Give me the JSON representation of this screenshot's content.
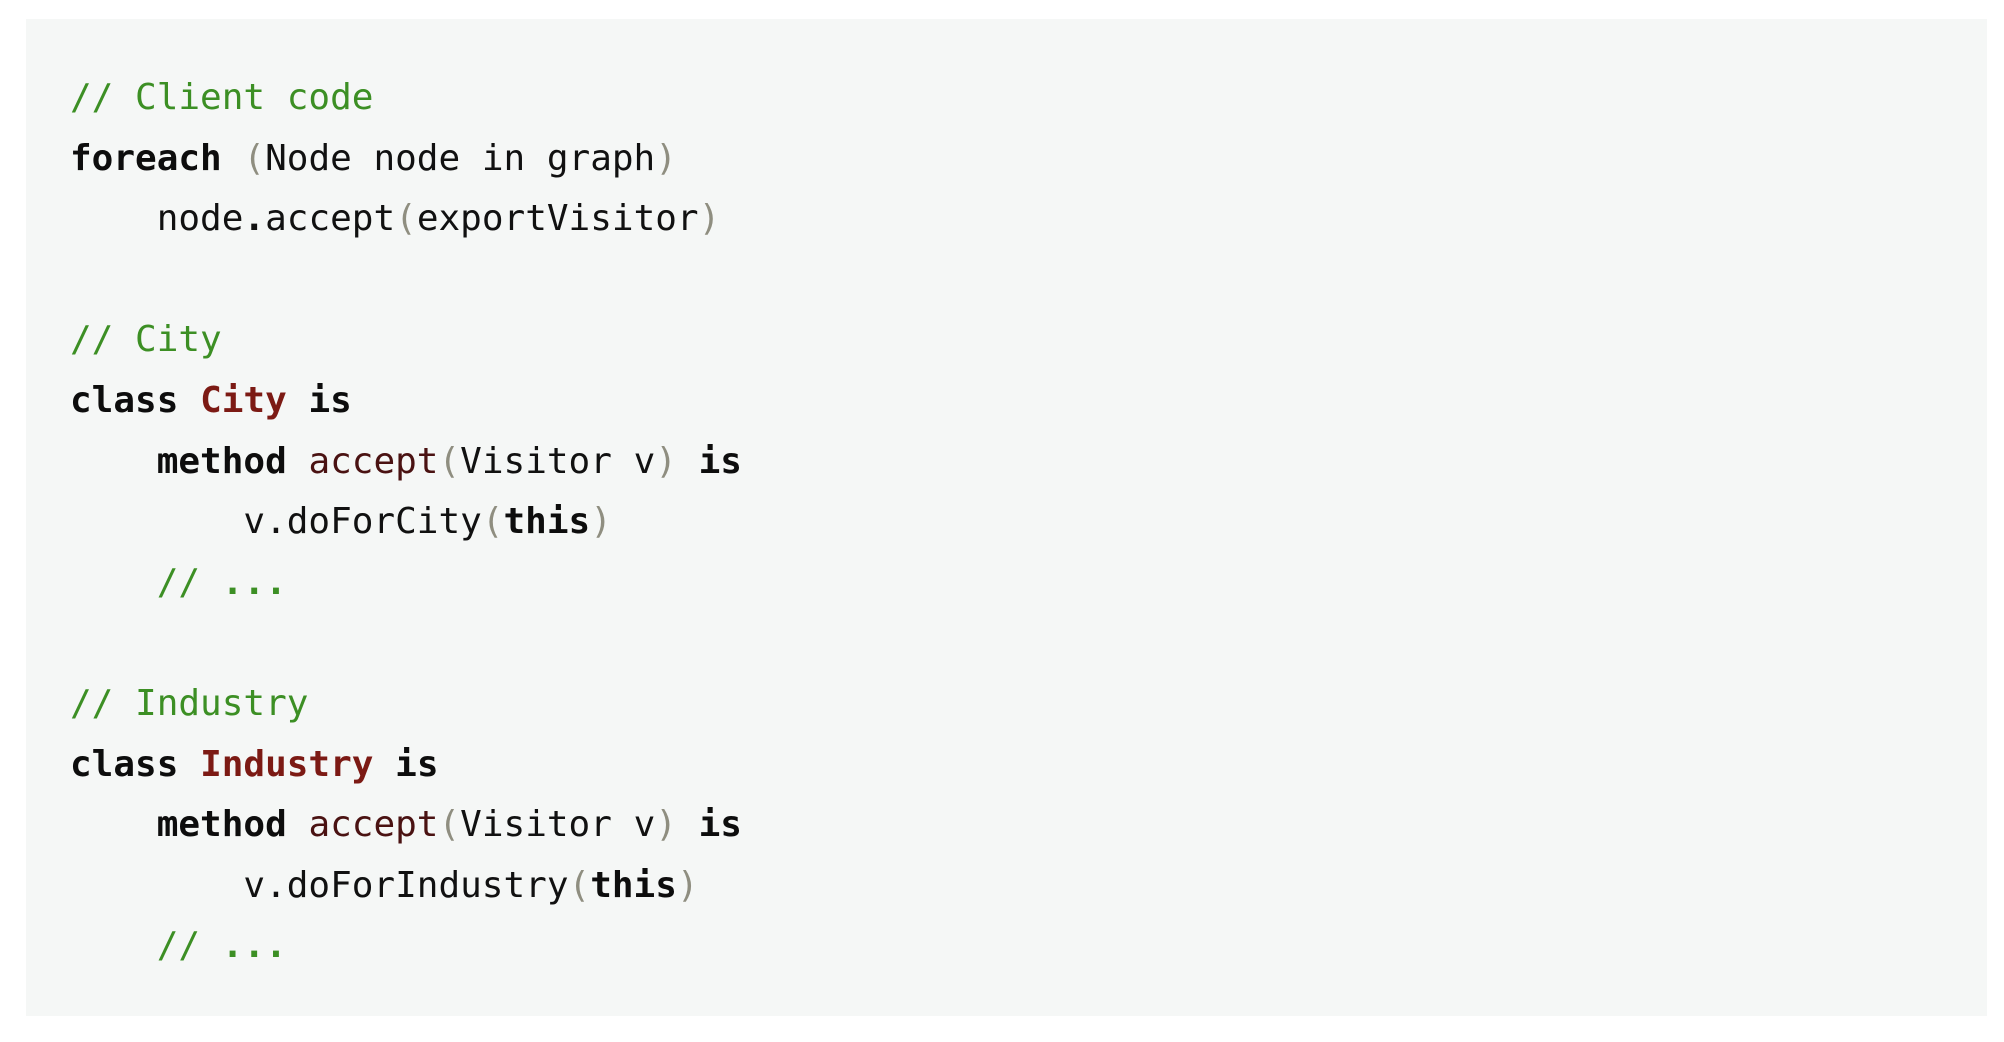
{
  "code": {
    "indent_unit": "    ",
    "lines": [
      {
        "indent": 0,
        "tokens": [
          {
            "t": "comment",
            "v": "// Client code"
          }
        ]
      },
      {
        "indent": 0,
        "tokens": [
          {
            "t": "kw",
            "v": "foreach"
          },
          {
            "t": "text",
            "v": " "
          },
          {
            "t": "punc",
            "v": "("
          },
          {
            "t": "text",
            "v": "Node node in graph"
          },
          {
            "t": "punc",
            "v": ")"
          }
        ]
      },
      {
        "indent": 1,
        "tokens": [
          {
            "t": "text",
            "v": "node"
          },
          {
            "t": "dot",
            "v": "."
          },
          {
            "t": "text",
            "v": "accept"
          },
          {
            "t": "punc",
            "v": "("
          },
          {
            "t": "text",
            "v": "exportVisitor"
          },
          {
            "t": "punc",
            "v": ")"
          }
        ]
      },
      {
        "indent": 0,
        "tokens": []
      },
      {
        "indent": 0,
        "tokens": [
          {
            "t": "comment",
            "v": "// City"
          }
        ]
      },
      {
        "indent": 0,
        "tokens": [
          {
            "t": "kw",
            "v": "class"
          },
          {
            "t": "text",
            "v": " "
          },
          {
            "t": "title",
            "v": "City"
          },
          {
            "t": "text",
            "v": " "
          },
          {
            "t": "kw",
            "v": "is"
          }
        ]
      },
      {
        "indent": 1,
        "tokens": [
          {
            "t": "kw",
            "v": "method"
          },
          {
            "t": "text",
            "v": " "
          },
          {
            "t": "fn",
            "v": "accept"
          },
          {
            "t": "punc",
            "v": "("
          },
          {
            "t": "text",
            "v": "Visitor v"
          },
          {
            "t": "punc",
            "v": ")"
          },
          {
            "t": "text",
            "v": " "
          },
          {
            "t": "kw",
            "v": "is"
          }
        ]
      },
      {
        "indent": 2,
        "tokens": [
          {
            "t": "text",
            "v": "v.doForCity"
          },
          {
            "t": "punc",
            "v": "("
          },
          {
            "t": "kw",
            "v": "this"
          },
          {
            "t": "punc",
            "v": ")"
          }
        ]
      },
      {
        "indent": 1,
        "tokens": [
          {
            "t": "comment",
            "v": "// "
          },
          {
            "t": "comment-bold",
            "v": "..."
          }
        ]
      },
      {
        "indent": 0,
        "tokens": []
      },
      {
        "indent": 0,
        "tokens": [
          {
            "t": "comment",
            "v": "// Industry"
          }
        ]
      },
      {
        "indent": 0,
        "tokens": [
          {
            "t": "kw",
            "v": "class"
          },
          {
            "t": "text",
            "v": " "
          },
          {
            "t": "title",
            "v": "Industry"
          },
          {
            "t": "text",
            "v": " "
          },
          {
            "t": "kw",
            "v": "is"
          }
        ]
      },
      {
        "indent": 1,
        "tokens": [
          {
            "t": "kw",
            "v": "method"
          },
          {
            "t": "text",
            "v": " "
          },
          {
            "t": "fn",
            "v": "accept"
          },
          {
            "t": "punc",
            "v": "("
          },
          {
            "t": "text",
            "v": "Visitor v"
          },
          {
            "t": "punc",
            "v": ")"
          },
          {
            "t": "text",
            "v": " "
          },
          {
            "t": "kw",
            "v": "is"
          }
        ]
      },
      {
        "indent": 2,
        "tokens": [
          {
            "t": "text",
            "v": "v.doForIndustry"
          },
          {
            "t": "punc",
            "v": "("
          },
          {
            "t": "kw",
            "v": "this"
          },
          {
            "t": "punc",
            "v": ")"
          }
        ]
      },
      {
        "indent": 1,
        "tokens": [
          {
            "t": "comment",
            "v": "// "
          },
          {
            "t": "comment-bold",
            "v": "..."
          }
        ]
      }
    ]
  }
}
